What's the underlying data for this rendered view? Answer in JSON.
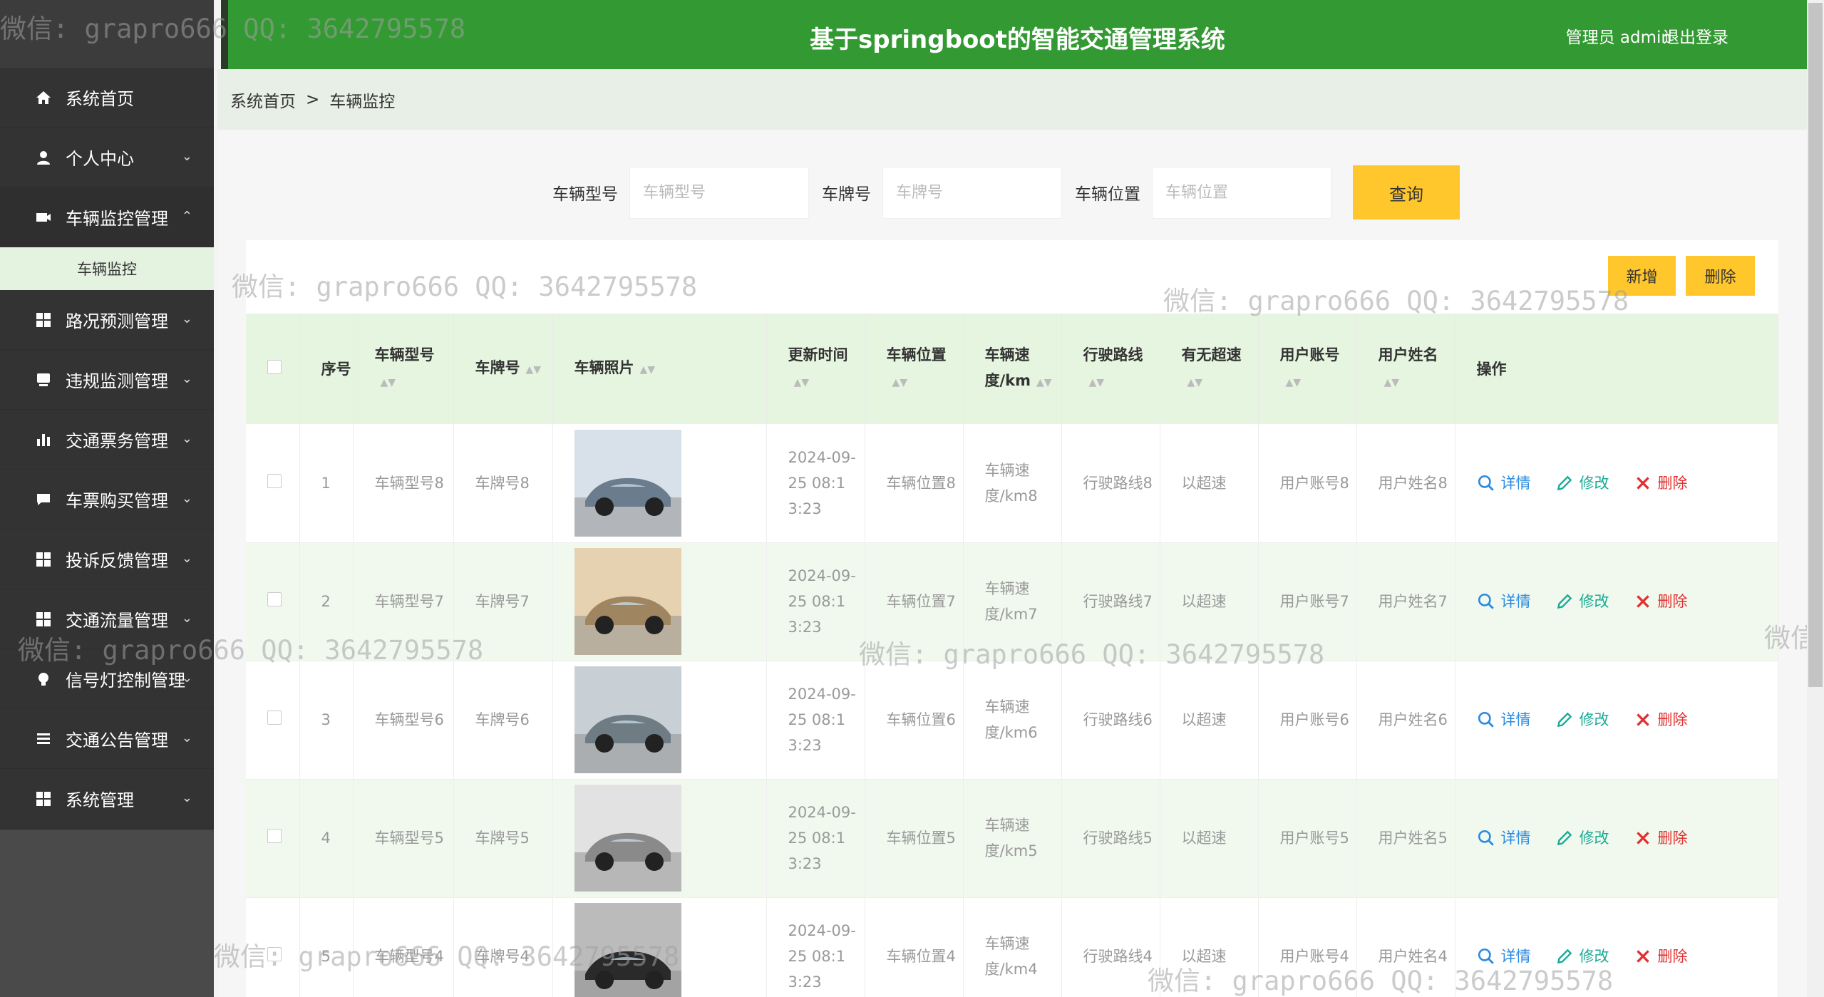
{
  "app": {
    "title": "基于springboot的智能交通管理系统",
    "user_label": "管理员 admin",
    "logout_label": "退出登录"
  },
  "breadcrumb": {
    "home": "系统首页",
    "separator": ">",
    "current": "车辆监控"
  },
  "sidebar": {
    "items": [
      {
        "label": "系统首页",
        "icon": "home-icon"
      },
      {
        "label": "个人中心",
        "icon": "user-icon"
      },
      {
        "label": "车辆监控管理",
        "icon": "camera-icon"
      },
      {
        "label": "路况预测管理",
        "icon": "grid-icon"
      },
      {
        "label": "违规监测管理",
        "icon": "monitor-icon"
      },
      {
        "label": "交通票务管理",
        "icon": "bar-chart-icon"
      },
      {
        "label": "车票购买管理",
        "icon": "chat-icon"
      },
      {
        "label": "投诉反馈管理",
        "icon": "grid-icon"
      },
      {
        "label": "交通流量管理",
        "icon": "grid-icon"
      },
      {
        "label": "信号灯控制管理",
        "icon": "bulb-icon"
      },
      {
        "label": "交通公告管理",
        "icon": "list-icon"
      },
      {
        "label": "系统管理",
        "icon": "grid-icon"
      }
    ],
    "sub_item": "车辆监控"
  },
  "search": {
    "model_label": "车辆型号",
    "model_placeholder": "车辆型号",
    "plate_label": "车牌号",
    "plate_placeholder": "车牌号",
    "location_label": "车辆位置",
    "location_placeholder": "车辆位置",
    "query_button": "查询"
  },
  "toolbar": {
    "add": "新增",
    "delete": "删除"
  },
  "table": {
    "headers": [
      "序号",
      "车辆型号",
      "车牌号",
      "车辆照片",
      "更新时间",
      "车辆位置",
      "车辆速度/km",
      "行驶路线",
      "有无超速",
      "用户账号",
      "用户姓名",
      "操作"
    ],
    "rows": [
      {
        "idx": "1",
        "model": "车辆型号8",
        "plate": "车牌号8",
        "time": "2024-09-25 08:13:23",
        "location": "车辆位置8",
        "speed": "车辆速度/km8",
        "route": "行驶路线8",
        "overspeed": "以超速",
        "account": "用户账号8",
        "name": "用户姓名8"
      },
      {
        "idx": "2",
        "model": "车辆型号7",
        "plate": "车牌号7",
        "time": "2024-09-25 08:13:23",
        "location": "车辆位置7",
        "speed": "车辆速度/km7",
        "route": "行驶路线7",
        "overspeed": "以超速",
        "account": "用户账号7",
        "name": "用户姓名7"
      },
      {
        "idx": "3",
        "model": "车辆型号6",
        "plate": "车牌号6",
        "time": "2024-09-25 08:13:23",
        "location": "车辆位置6",
        "speed": "车辆速度/km6",
        "route": "行驶路线6",
        "overspeed": "以超速",
        "account": "用户账号6",
        "name": "用户姓名6"
      },
      {
        "idx": "4",
        "model": "车辆型号5",
        "plate": "车牌号5",
        "time": "2024-09-25 08:13:23",
        "location": "车辆位置5",
        "speed": "车辆速度/km5",
        "route": "行驶路线5",
        "overspeed": "以超速",
        "account": "用户账号5",
        "name": "用户姓名5"
      },
      {
        "idx": "5",
        "model": "车辆型号4",
        "plate": "车牌号4",
        "time": "2024-09-25 08:13:23",
        "location": "车辆位置4",
        "speed": "车辆速度/km4",
        "route": "行驶路线4",
        "overspeed": "以超速",
        "account": "用户账号4",
        "name": "用户姓名4"
      }
    ],
    "ops": {
      "detail": "详情",
      "edit": "修改",
      "delete": "删除"
    }
  },
  "watermark": "微信: grapro666 QQ: 3642795578",
  "colors": {
    "header": "#339933",
    "sidebar": "#333333",
    "accent_button": "#ffc72c",
    "detail": "#2a8ae0",
    "edit": "#1aaa96",
    "delete": "#e03030"
  }
}
